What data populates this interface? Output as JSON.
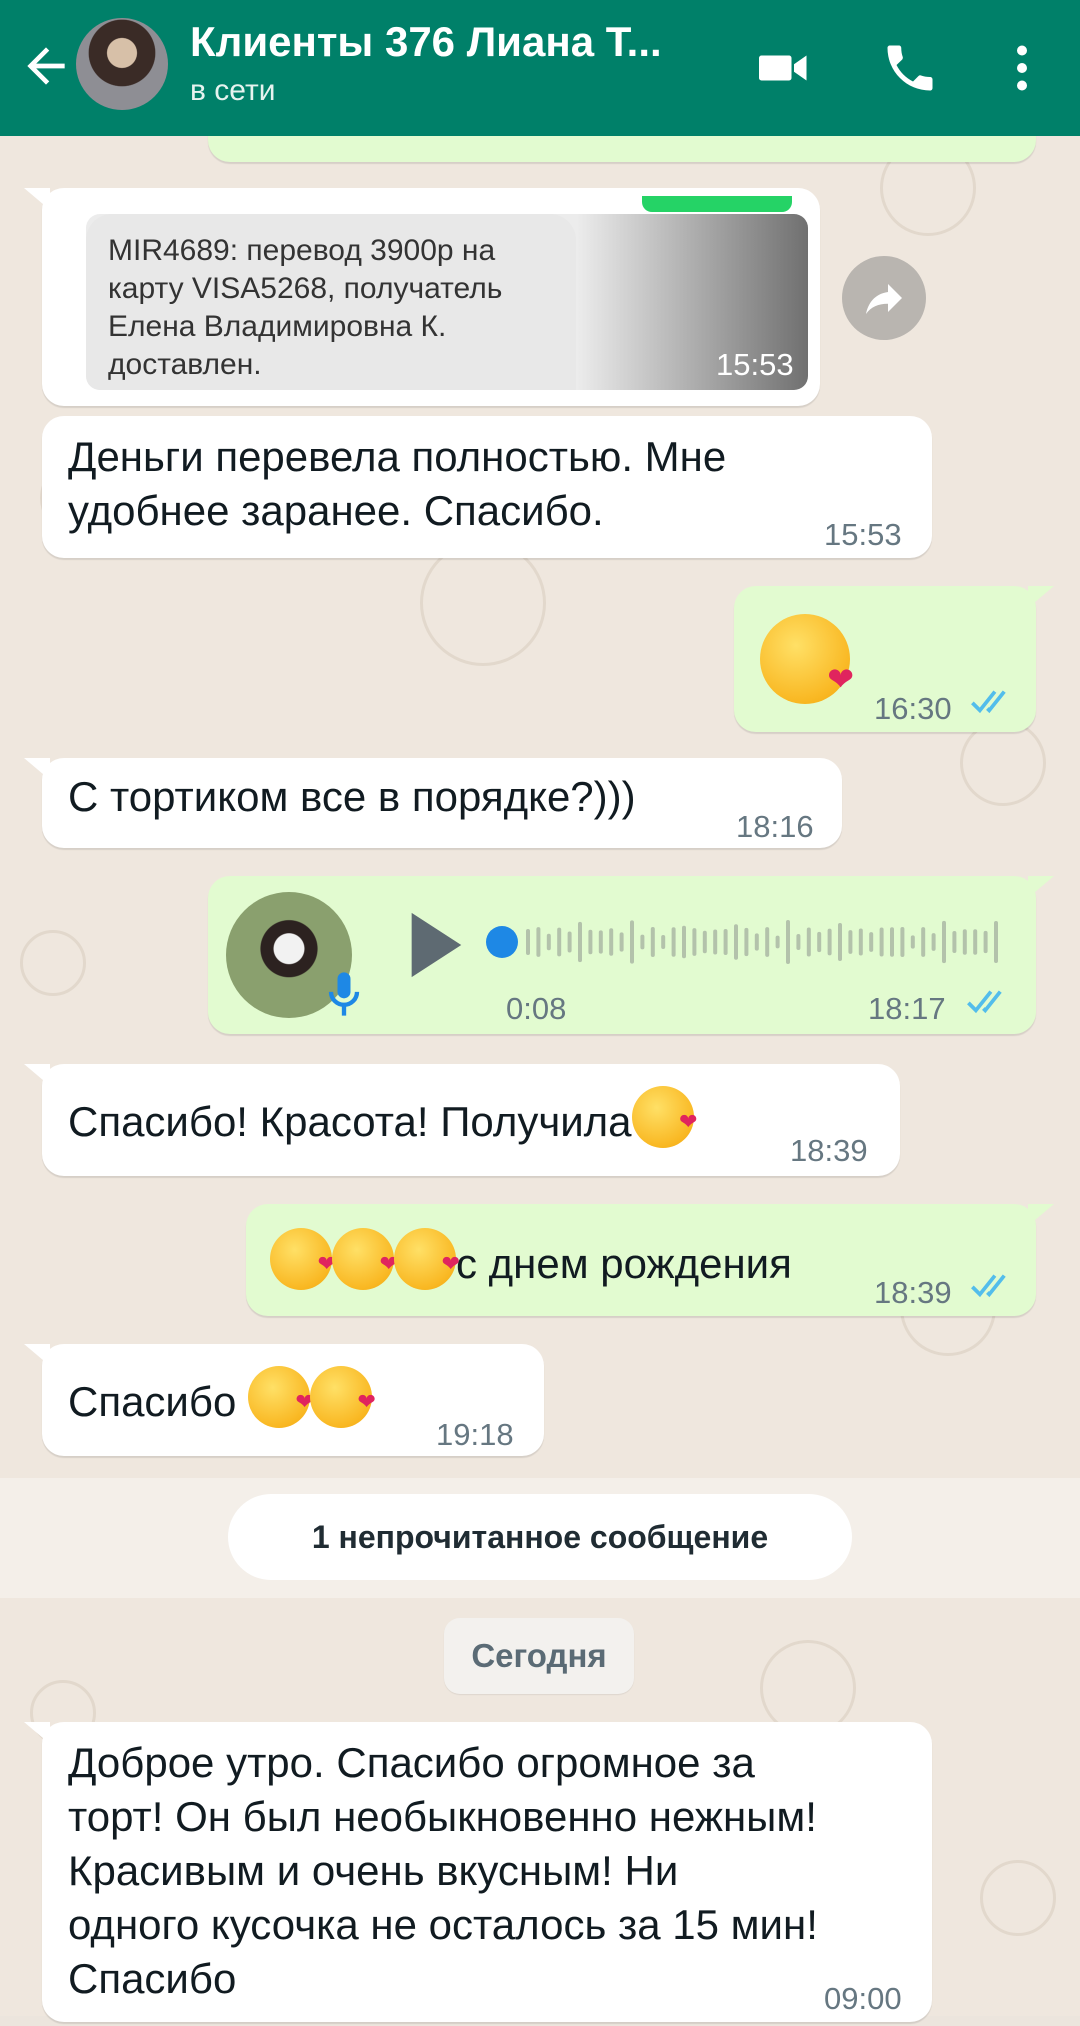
{
  "header": {
    "title": "Клиенты 376 Лиана Т...",
    "status": "в сети"
  },
  "messages": {
    "image_msg": {
      "sms_text": "MIR4689: перевод 3900р на\nкарту VISA5268, получатель\nЕлена Владимировна К.\nдоставлен.",
      "time": "15:53"
    },
    "m1": {
      "text1": "Деньги перевела полностью. Мне",
      "text2": "удобнее заранее. Спасибо.",
      "time": "15:53"
    },
    "m2": {
      "time": "16:30"
    },
    "m3": {
      "text": "С тортиком все в порядке?)))",
      "time": "18:16"
    },
    "voice": {
      "duration": "0:08",
      "time": "18:17"
    },
    "m4": {
      "text": "Спасибо! Красота! Получила",
      "time": "18:39"
    },
    "m5": {
      "text": "с днем рождения",
      "time": "18:39"
    },
    "m6": {
      "text": "Спасибо ",
      "time": "19:18"
    },
    "m7": {
      "line1": "Доброе утро. Спасибо огромное за",
      "line2": "торт! Он был необыкновенно нежным!",
      "line3": "Красивым и очень вкусным! Ни",
      "line4": "одного кусочка не осталось за 15 мин!",
      "line5": "Спасибо",
      "time": "09:00"
    }
  },
  "unread_label": "1 непрочитанное сообщение",
  "date_label": "Сегодня",
  "colors": {
    "header": "#008069",
    "outgoing_bubble": "#e2fbd0",
    "incoming_bubble": "#ffffff",
    "read_ticks": "#53bdeb",
    "voice_dot": "#1e88e5"
  }
}
